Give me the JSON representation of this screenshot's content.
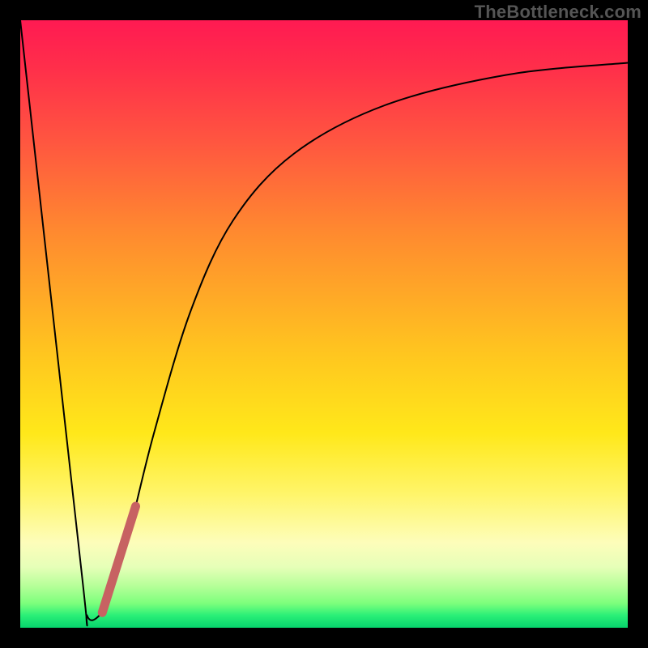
{
  "watermark": "TheBottleneck.com",
  "chart_data": {
    "type": "line",
    "title": "",
    "xlabel": "",
    "ylabel": "",
    "xlim": [
      0,
      100
    ],
    "ylim": [
      0,
      100
    ],
    "grid": false,
    "legend": false,
    "background_gradient": {
      "direction": "vertical",
      "stops": [
        {
          "pos": 0.0,
          "color": "#ff1a52"
        },
        {
          "pos": 0.35,
          "color": "#ff8a2f"
        },
        {
          "pos": 0.68,
          "color": "#ffe81a"
        },
        {
          "pos": 0.9,
          "color": "#e6ffb8"
        },
        {
          "pos": 1.0,
          "color": "#06d36c"
        }
      ]
    },
    "series": [
      {
        "name": "bottleneck-curve",
        "color": "#000000",
        "stroke_width": 2,
        "data": [
          {
            "x": 0,
            "y": 100
          },
          {
            "x": 10,
            "y": 10
          },
          {
            "x": 11,
            "y": 2
          },
          {
            "x": 13,
            "y": 2
          },
          {
            "x": 15,
            "y": 6
          },
          {
            "x": 18,
            "y": 16
          },
          {
            "x": 22,
            "y": 32
          },
          {
            "x": 28,
            "y": 52
          },
          {
            "x": 35,
            "y": 67
          },
          {
            "x": 45,
            "y": 78
          },
          {
            "x": 60,
            "y": 86
          },
          {
            "x": 80,
            "y": 91
          },
          {
            "x": 100,
            "y": 93
          }
        ]
      },
      {
        "name": "highlight-segment",
        "color": "#c76262",
        "stroke_width": 11,
        "stroke_linecap": "round",
        "data": [
          {
            "x": 13.5,
            "y": 2.5
          },
          {
            "x": 19.0,
            "y": 20.0
          }
        ]
      }
    ]
  },
  "colors": {
    "page_bg": "#000000",
    "curve": "#000000",
    "highlight": "#c76262",
    "watermark": "#555555"
  }
}
